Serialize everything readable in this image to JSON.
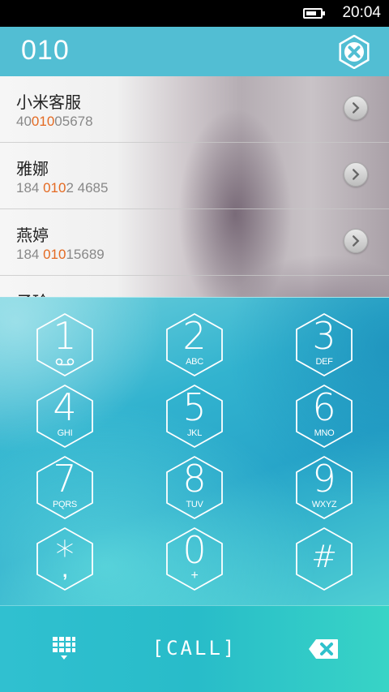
{
  "status_bar": {
    "time": "20:04"
  },
  "header": {
    "dialed_number": "010"
  },
  "results": [
    {
      "name": "小米客服",
      "phone_before": "40",
      "phone_match": "010",
      "phone_after": "05678"
    },
    {
      "name": "雅娜",
      "phone_before": "184 ",
      "phone_match": "010",
      "phone_after": "2 4685"
    },
    {
      "name": "燕婷",
      "phone_before": "184 ",
      "phone_match": "010",
      "phone_after": "15689"
    },
    {
      "name": "子玲"
    }
  ],
  "keypad": {
    "keys": [
      {
        "digit": "1",
        "sub_icon": "voicemail-icon"
      },
      {
        "digit": "2",
        "letters": "ABC"
      },
      {
        "digit": "3",
        "letters": "DEF"
      },
      {
        "digit": "4",
        "letters": "GHI"
      },
      {
        "digit": "5",
        "letters": "JKL"
      },
      {
        "digit": "6",
        "letters": "MNO"
      },
      {
        "digit": "7",
        "letters": "PQRS"
      },
      {
        "digit": "8",
        "letters": "TUV"
      },
      {
        "digit": "9",
        "letters": "WXYZ"
      },
      {
        "digit": "*",
        "letters": ","
      },
      {
        "digit": "0",
        "letters": "+"
      },
      {
        "digit": "#"
      }
    ]
  },
  "bottom_bar": {
    "call_label": "[CALL]",
    "left_icon": "dialpad-icon",
    "right_icon": "backspace-icon"
  },
  "colors": {
    "header_bg": "#52bed3",
    "match_highlight": "#e46a22",
    "key_stroke": "#ffffff"
  }
}
